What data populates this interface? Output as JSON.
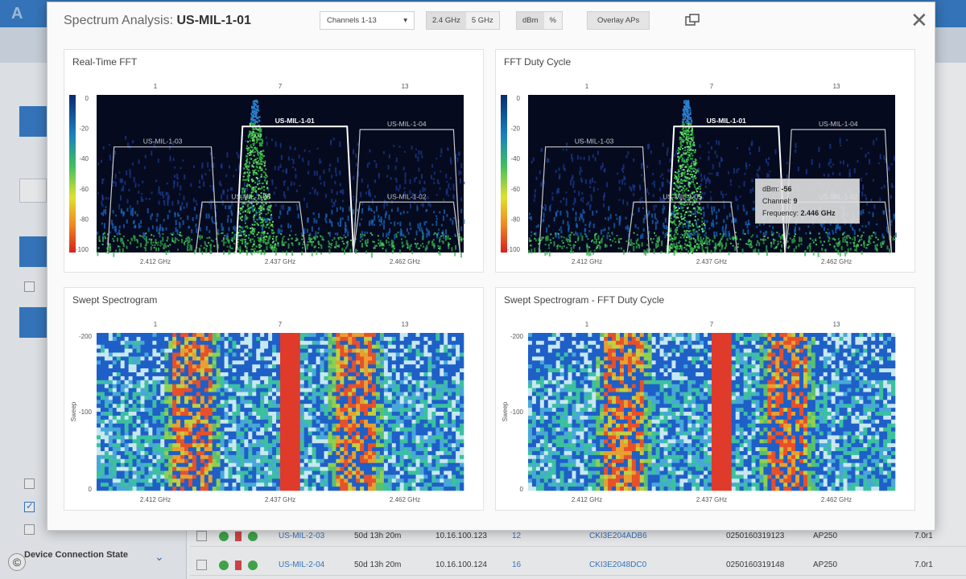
{
  "modal": {
    "title_prefix": "Spectrum Analysis: ",
    "title_ap": "US-MIL-1-01",
    "channel_select": "Channels 1-13",
    "band_options": [
      "2.4 GHz",
      "5 GHz"
    ],
    "unit_options": [
      "dBm",
      "%"
    ],
    "overlay_label": "Overlay APs",
    "close_glyph": "✕"
  },
  "panels": {
    "realtime": {
      "title": "Real-Time FFT"
    },
    "dutycycle": {
      "title": "FFT Duty Cycle"
    },
    "swept": {
      "title": "Swept Spectrogram"
    },
    "swept_duty": {
      "title": "Swept Spectrogram - FFT Duty Cycle"
    }
  },
  "chart_data": [
    {
      "type": "heatmap",
      "title": "Real-Time FFT",
      "channel_ticks": [
        "1",
        "7",
        "13"
      ],
      "freq_ticks": [
        "2.412 GHz",
        "2.437 GHz",
        "2.462 GHz"
      ],
      "y_ticks": [
        "0",
        "-20",
        "-40",
        "-60",
        "-80",
        "-100"
      ],
      "ap_overlays": [
        {
          "name": "US-MIL-1-03",
          "channel": 1
        },
        {
          "name": "US-MIL-1-01",
          "channel": 6
        },
        {
          "name": "US-MIL-1-04",
          "channel": 11
        },
        {
          "name": "US-MIL-1-05",
          "channel": 5
        },
        {
          "name": "US-MIL-1-02",
          "channel": 11
        }
      ]
    },
    {
      "type": "heatmap",
      "title": "FFT Duty Cycle",
      "channel_ticks": [
        "1",
        "7",
        "13"
      ],
      "freq_ticks": [
        "2.412 GHz",
        "2.437 GHz",
        "2.462 GHz"
      ],
      "y_ticks": [
        "0",
        "-20",
        "-40",
        "-60",
        "-80",
        "-100"
      ],
      "tooltip": {
        "dbm_label": "dBm:",
        "dbm": "-56",
        "channel_label": "Channel:",
        "channel": "9",
        "freq_label": "Frequency:",
        "freq": "2.446 GHz"
      }
    },
    {
      "type": "heatmap",
      "title": "Swept Spectrogram",
      "channel_ticks": [
        "1",
        "7",
        "13"
      ],
      "freq_ticks": [
        "2.412 GHz",
        "2.437 GHz",
        "2.462 GHz"
      ],
      "y_ticks": [
        "-200",
        "-100",
        "0"
      ],
      "ylabel": "Sweep"
    },
    {
      "type": "heatmap",
      "title": "Swept Spectrogram - FFT Duty Cycle",
      "channel_ticks": [
        "1",
        "7",
        "13"
      ],
      "freq_ticks": [
        "2.412 GHz",
        "2.437 GHz",
        "2.462 GHz"
      ],
      "y_ticks": [
        "-200",
        "-100",
        "0"
      ],
      "ylabel": "Sweep"
    }
  ],
  "background": {
    "side_labels": [
      "Device Connection State"
    ],
    "rows": [
      {
        "name": "US-MIL-2-03",
        "uptime": "50d 13h 20m",
        "ip": "10.16.100.123",
        "ch": "12",
        "serial": "CKI3E204ADB6",
        "model": "AP250",
        "ver": "7.0r1",
        "id": "0250160319123"
      },
      {
        "name": "US-MIL-2-04",
        "uptime": "50d 13h 20m",
        "ip": "10.16.100.124",
        "ch": "16",
        "serial": "CKI3E2048DC0",
        "model": "AP250",
        "ver": "7.0r1",
        "id": "0250160319148"
      }
    ]
  }
}
